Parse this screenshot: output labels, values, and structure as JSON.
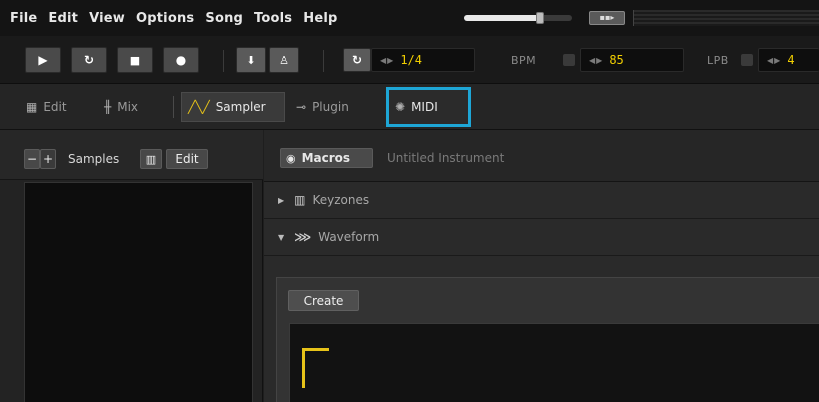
{
  "menubar": {
    "items": [
      "File",
      "Edit",
      "View",
      "Options",
      "Song",
      "Tools",
      "Help"
    ],
    "master_volume": 0.7
  },
  "transport": {
    "edit_step": "1/4",
    "bpm_label": "BPM",
    "bpm_value": "85",
    "lpb_label": "LPB",
    "lpb_value": "4"
  },
  "tabs": [
    {
      "label": "Edit",
      "icon": "pattern-grid-icon"
    },
    {
      "label": "Mix",
      "icon": "mixer-faders-icon"
    },
    {
      "label": "Sampler",
      "icon": "waveform-zigzag-icon",
      "selected": true
    },
    {
      "label": "Plugin",
      "icon": "plug-icon"
    },
    {
      "label": "MIDI",
      "icon": "midi-connector-icon",
      "highlighted": true
    }
  ],
  "left": {
    "minus": "−",
    "plus": "+",
    "samples_label": "Samples",
    "edit_label": "Edit"
  },
  "right": {
    "macros_label": "Macros",
    "instrument_name": "Untitled Instrument",
    "keyzones_label": "Keyzones",
    "waveform_label": "Waveform",
    "create_label": "Create"
  },
  "colors": {
    "accent_yellow": "#f2cf00",
    "highlight_blue": "#1ea6d6",
    "sampler_icon": "#e7c319"
  }
}
